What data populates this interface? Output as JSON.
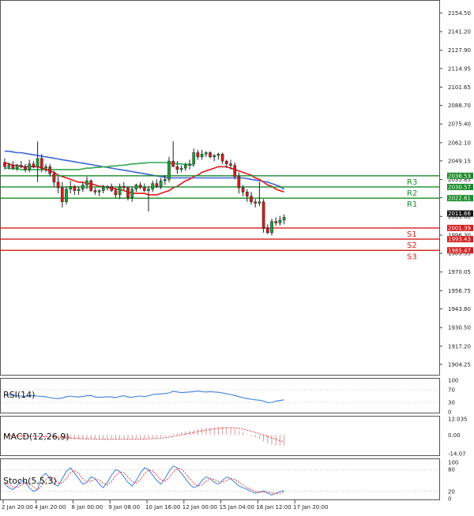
{
  "chart_data": {
    "type": "candlestick",
    "main": {
      "ylim": [
        1898,
        2162
      ],
      "y_ticks": [
        "2154.50",
        "2141.20",
        "2127.90",
        "2114.95",
        "2101.65",
        "2088.70",
        "2075.40",
        "2062.10",
        "2049.15",
        "2035.85",
        "2022.90",
        "2009.60",
        "1996.30",
        "1983.35",
        "1970.05",
        "1956.75",
        "1943.80",
        "1930.50",
        "1917.20",
        "1904.25"
      ],
      "candles": [
        [
          2048,
          2051,
          2043,
          2045
        ],
        [
          2045,
          2048,
          2043,
          2046
        ],
        [
          2046,
          2049,
          2043,
          2044
        ],
        [
          2044,
          2047,
          2042,
          2046
        ],
        [
          2046,
          2049,
          2044,
          2045
        ],
        [
          2045,
          2047,
          2041,
          2043
        ],
        [
          2043,
          2050,
          2041,
          2047
        ],
        [
          2047,
          2049,
          2044,
          2045
        ],
        [
          2045,
          2063,
          2034,
          2051
        ],
        [
          2051,
          2054,
          2041,
          2044
        ],
        [
          2044,
          2047,
          2041,
          2045
        ],
        [
          2045,
          2047,
          2038,
          2040
        ],
        [
          2040,
          2042,
          2031,
          2034
        ],
        [
          2034,
          2038,
          2026,
          2030
        ],
        [
          2030,
          2034,
          2016,
          2020
        ],
        [
          2020,
          2031,
          2018,
          2029
        ],
        [
          2029,
          2035,
          2026,
          2031
        ],
        [
          2031,
          2032,
          2025,
          2028
        ],
        [
          2028,
          2031,
          2025,
          2029
        ],
        [
          2029,
          2034,
          2027,
          2032
        ],
        [
          2032,
          2038,
          2029,
          2035
        ],
        [
          2035,
          2036,
          2027,
          2028
        ],
        [
          2028,
          2030,
          2025,
          2027
        ],
        [
          2027,
          2029,
          2024,
          2028
        ],
        [
          2028,
          2032,
          2026,
          2030
        ],
        [
          2030,
          2032,
          2028,
          2031
        ],
        [
          2031,
          2033,
          2027,
          2028
        ],
        [
          2028,
          2030,
          2023,
          2025
        ],
        [
          2025,
          2033,
          2022,
          2031
        ],
        [
          2031,
          2034,
          2028,
          2030
        ],
        [
          2030,
          2031,
          2021,
          2023
        ],
        [
          2023,
          2031,
          2020,
          2029
        ],
        [
          2029,
          2033,
          2027,
          2032
        ],
        [
          2032,
          2034,
          2029,
          2030
        ],
        [
          2030,
          2033,
          2027,
          2028
        ],
        [
          2028,
          2031,
          2013,
          2029
        ],
        [
          2029,
          2035,
          2027,
          2033
        ],
        [
          2033,
          2036,
          2030,
          2031
        ],
        [
          2031,
          2037,
          2029,
          2035
        ],
        [
          2035,
          2039,
          2032,
          2036
        ],
        [
          2036,
          2052,
          2034,
          2049
        ],
        [
          2049,
          2063,
          2046,
          2045
        ],
        [
          2045,
          2049,
          2040,
          2043
        ],
        [
          2043,
          2046,
          2041,
          2044
        ],
        [
          2044,
          2048,
          2042,
          2046
        ],
        [
          2046,
          2050,
          2043,
          2047
        ],
        [
          2047,
          2058,
          2045,
          2055
        ],
        [
          2055,
          2057,
          2050,
          2052
        ],
        [
          2052,
          2057,
          2050,
          2054
        ],
        [
          2054,
          2056,
          2052,
          2055
        ],
        [
          2055,
          2056,
          2051,
          2052
        ],
        [
          2052,
          2054,
          2049,
          2053
        ],
        [
          2053,
          2055,
          2050,
          2054
        ],
        [
          2054,
          2055,
          2047,
          2049
        ],
        [
          2049,
          2050,
          2044,
          2047
        ],
        [
          2047,
          2050,
          2043,
          2046
        ],
        [
          2046,
          2048,
          2036,
          2038
        ],
        [
          2038,
          2041,
          2026,
          2030
        ],
        [
          2030,
          2032,
          2024,
          2027
        ],
        [
          2027,
          2029,
          2020,
          2024
        ],
        [
          2024,
          2027,
          2018,
          2020
        ],
        [
          2020,
          2022,
          2016,
          2019
        ],
        [
          2019,
          2034,
          2017,
          2020
        ],
        [
          2020,
          2022,
          1998,
          2001
        ],
        [
          2001,
          2004,
          1997,
          1998
        ],
        [
          1998,
          2008,
          1996,
          2006
        ],
        [
          2006,
          2009,
          2003,
          2005
        ],
        [
          2005,
          2010,
          2003,
          2007
        ],
        [
          2007,
          2011,
          2004,
          2009
        ]
      ],
      "ma_fast": [
        2048,
        2047,
        2046,
        2046,
        2045,
        2045,
        2045,
        2045,
        2045,
        2044,
        2043,
        2042,
        2041,
        2039,
        2038,
        2037,
        2036,
        2035,
        2034,
        2034,
        2033,
        2033,
        2032,
        2031,
        2031,
        2030,
        2030,
        2029,
        2029,
        2028,
        2027,
        2026,
        2026,
        2026,
        2026,
        2025,
        2025,
        2025,
        2026,
        2027,
        2028,
        2030,
        2031,
        2033,
        2035,
        2036,
        2038,
        2039,
        2041,
        2042,
        2043,
        2044,
        2045,
        2045,
        2045,
        2044,
        2043,
        2042,
        2041,
        2040,
        2039,
        2037,
        2036,
        2034,
        2032,
        2031,
        2029,
        2028,
        2027
      ],
      "ma_slow": [
        2056,
        2056,
        2055.5,
        2055,
        2055,
        2054.5,
        2054,
        2053.5,
        2053,
        2052.5,
        2052,
        2051.5,
        2051,
        2050.5,
        2050,
        2049.5,
        2049,
        2048.5,
        2048,
        2047.5,
        2047,
        2046.5,
        2046,
        2045.5,
        2045,
        2044.5,
        2044,
        2043.5,
        2043,
        2042.5,
        2042,
        2041.5,
        2041,
        2040.5,
        2040,
        2039.5,
        2039,
        2038.5,
        2038,
        2037.5,
        2037,
        2037,
        2037,
        2037,
        2037,
        2037,
        2037,
        2037,
        2037,
        2037,
        2037,
        2037,
        2037,
        2037,
        2037,
        2037,
        2037,
        2037,
        2037,
        2036.5,
        2036,
        2035.5,
        2035,
        2034.5,
        2034,
        2033,
        2032,
        2031,
        2029
      ],
      "ma_mid": [
        2044,
        2044,
        2043.5,
        2043.5,
        2043,
        2043,
        2043,
        2043,
        2043,
        2043,
        2043,
        2043,
        2043,
        2043,
        2043,
        2043,
        2043,
        2043,
        2043,
        2043.5,
        2044,
        2044,
        2044.5,
        2044.5,
        2045,
        2045,
        2045.5,
        2045.5,
        2046,
        2046,
        2046.5,
        2047,
        2047,
        2047.5,
        2047.5,
        2048,
        2048,
        2048,
        2048,
        2048,
        2047.5,
        2047.5,
        2047,
        2047,
        2046.5,
        2046.5,
        2046
      ],
      "levels": [
        {
          "label": "R3",
          "value": 2038.53,
          "tag": "2038.53"
        },
        {
          "label": "R2",
          "value": 2030.57,
          "tag": "2030.57"
        },
        {
          "label": "R1",
          "value": 2022.61,
          "tag": "2022.61"
        },
        {
          "label": "S1",
          "value": 2001.39,
          "tag": "2001.39"
        },
        {
          "label": "S2",
          "value": 1993.43,
          "tag": "1993.43"
        },
        {
          "label": "S3",
          "value": 1985.47,
          "tag": "1985.47"
        }
      ],
      "current_price": "2011.66"
    },
    "rsi": {
      "label": "RSI(14)",
      "y_ticks": [
        "100",
        "70",
        "30",
        "0"
      ],
      "ylim": [
        0,
        100
      ],
      "values": [
        55,
        54,
        52,
        51,
        50,
        49,
        50,
        51,
        50,
        49,
        48,
        45,
        43,
        42,
        44,
        48,
        50,
        48,
        47,
        49,
        51,
        52,
        47,
        46,
        47,
        48,
        47,
        45,
        49,
        51,
        47,
        46,
        49,
        50,
        48,
        51,
        55,
        56,
        57,
        58,
        60,
        65,
        63,
        61,
        62,
        63,
        64,
        66,
        64,
        63,
        64,
        63,
        62,
        60,
        57,
        55,
        52,
        48,
        45,
        42,
        40,
        38,
        37,
        34,
        29,
        30,
        34,
        36,
        38
      ]
    },
    "macd": {
      "label": "MACD(12,26,9)",
      "y_ticks": [
        "12.035",
        "0.00",
        "-14.07"
      ],
      "ylim": [
        -14.07,
        12.035
      ],
      "hist": [
        -1.0,
        -1.1,
        -1.2,
        -1.3,
        -1.4,
        -1.4,
        -1.5,
        -1.5,
        -1.6,
        -1.6,
        -1.7,
        -1.8,
        -2.0,
        -2.3,
        -2.8,
        -3.0,
        -3.1,
        -3.3,
        -3.4,
        -3.4,
        -3.3,
        -3.2,
        -3.3,
        -3.4,
        -3.3,
        -3.3,
        -3.3,
        -3.5,
        -3.3,
        -3.2,
        -3.4,
        -3.3,
        -3.1,
        -3.0,
        -2.9,
        -2.7,
        -2.3,
        -1.9,
        -1.5,
        -1.0,
        -0.3,
        0.8,
        1.5,
        2.1,
        2.6,
        3.1,
        3.9,
        4.5,
        5.0,
        5.4,
        5.7,
        6.0,
        6.2,
        6.1,
        5.8,
        5.4,
        4.6,
        3.3,
        2.0,
        0.6,
        -0.8,
        -2.0,
        -3.0,
        -4.8,
        -6.5,
        -7.4,
        -7.8,
        -7.9,
        -8.0
      ],
      "signal": [
        -0.3,
        -0.4,
        -0.5,
        -0.6,
        -0.7,
        -0.8,
        -0.9,
        -1.0,
        -1.1,
        -1.2,
        -1.3,
        -1.4,
        -1.5,
        -1.7,
        -1.9,
        -2.1,
        -2.3,
        -2.5,
        -2.7,
        -2.8,
        -2.9,
        -3.0,
        -3.1,
        -3.2,
        -3.2,
        -3.3,
        -3.3,
        -3.3,
        -3.3,
        -3.3,
        -3.3,
        -3.3,
        -3.3,
        -3.2,
        -3.1,
        -3.0,
        -2.8,
        -2.6,
        -2.3,
        -2.0,
        -1.6,
        -1.1,
        -0.5,
        0.1,
        0.7,
        1.3,
        1.9,
        2.5,
        3.1,
        3.6,
        4.1,
        4.6,
        5.0,
        5.3,
        5.5,
        5.5,
        5.3,
        4.9,
        4.3,
        3.6,
        2.8,
        1.9,
        1.0,
        0.0,
        -1.1,
        -2.2,
        -3.3,
        -4.3,
        -5.2
      ]
    },
    "stoch": {
      "label": "Stoch(5,5,3)",
      "y_ticks": [
        "100",
        "80",
        "20",
        "0"
      ],
      "ylim": [
        0,
        100
      ],
      "k": [
        40,
        30,
        25,
        35,
        50,
        45,
        30,
        20,
        25,
        60,
        70,
        55,
        40,
        35,
        55,
        75,
        85,
        70,
        55,
        40,
        45,
        60,
        55,
        40,
        30,
        45,
        65,
        80,
        75,
        60,
        45,
        35,
        50,
        70,
        85,
        80,
        65,
        50,
        40,
        55,
        75,
        90,
        85,
        70,
        55,
        40,
        30,
        35,
        50,
        60,
        55,
        45,
        40,
        50,
        60,
        55,
        45,
        35,
        30,
        25,
        20,
        15,
        18,
        22,
        15,
        10,
        15,
        20,
        22
      ],
      "d": [
        45,
        38,
        32,
        30,
        37,
        43,
        42,
        32,
        25,
        35,
        52,
        62,
        55,
        43,
        43,
        55,
        72,
        77,
        70,
        55,
        47,
        48,
        53,
        52,
        42,
        38,
        47,
        63,
        73,
        72,
        60,
        47,
        43,
        52,
        68,
        78,
        77,
        65,
        52,
        48,
        57,
        73,
        83,
        82,
        70,
        55,
        42,
        35,
        38,
        48,
        55,
        53,
        47,
        45,
        50,
        55,
        53,
        45,
        37,
        30,
        25,
        20,
        18,
        18,
        18,
        16,
        13,
        15,
        19
      ]
    },
    "x_ticks": [
      "2 Jan 20:00",
      "4 Jan 20:00",
      "8 Jan 00:00",
      "9 Jan 08:00",
      "10 Jan 16:00",
      "12 Jan 00:00",
      "15 Jan 04:00",
      "16 Jan 12:00",
      "17 Jan 20:00"
    ]
  },
  "colors": {
    "bull": "#1f9e3a",
    "bear": "#d21f1f",
    "ma_fast": "#e01818",
    "ma_slow": "#3f66d6",
    "ma_mid": "#2fa84f",
    "resistance": "#1a8a2a",
    "support": "#d21f1f",
    "oscillator": "#3f7fd9",
    "macd_hist": "#d89a9a",
    "signal": "#e04040"
  }
}
